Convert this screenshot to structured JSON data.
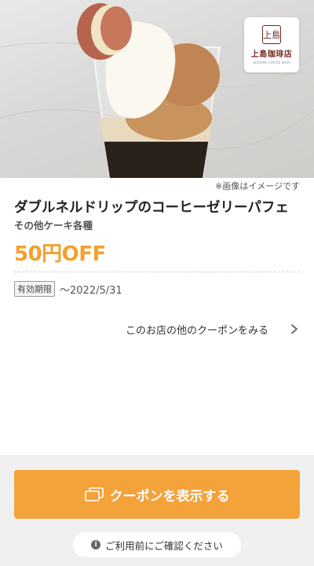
{
  "hero": {
    "image_note": "※画像はイメージです",
    "logo_name": "上島珈琲店",
    "logo_sub": "UESHIMA COFFEE SHOP",
    "logo_mark": "上島"
  },
  "coupon": {
    "title": "ダブルネルドリップのコーヒーゼリーパフェ",
    "subtitle": "その他ケーキ各種",
    "discount": "50円OFF",
    "validity_label": "有効期限",
    "validity_date": "〜2022/5/31"
  },
  "links": {
    "other_coupons": "このお店の他のクーポンをみる"
  },
  "actions": {
    "show_coupon": "クーポンを表示する",
    "confirm_notice": "ご利用前にご確認ください"
  },
  "colors": {
    "accent": "#f4a23a",
    "discount_text": "#f4a02d",
    "bottom_bg": "#f0f0f0"
  },
  "icons": [
    "ticket-icon",
    "chevron-right-icon",
    "info-icon"
  ]
}
